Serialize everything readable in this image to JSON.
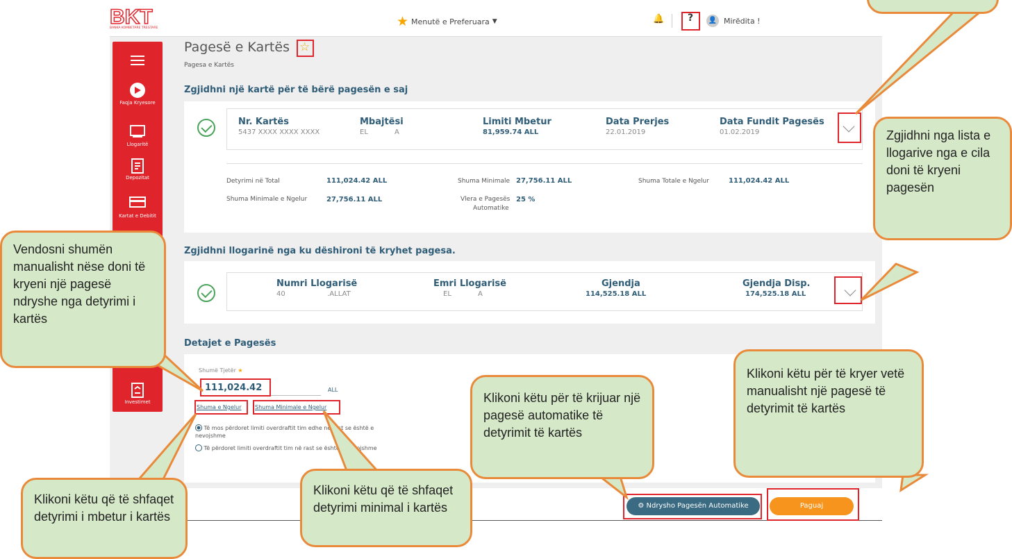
{
  "logo": {
    "text": "BKT",
    "subtitle": "BANKA KOMBETARE TREGTARE"
  },
  "topbar": {
    "favorites_label": "Menutë e Preferuara",
    "help_label": "?",
    "greeting": "Mirëdita !"
  },
  "sidebar": {
    "items": [
      {
        "label": "Faqja Kryesore"
      },
      {
        "label": "Llogaritë"
      },
      {
        "label": "Depozitat"
      },
      {
        "label": "Kartat e Debitit"
      },
      {
        "label": "Investimet"
      }
    ]
  },
  "page": {
    "title": "Pagesë e Kartës",
    "breadcrumb": "Pagesa e Kartës"
  },
  "card_section": {
    "title": "Zgjidhni një kartë për të bërë pagesën e saj",
    "columns": [
      "Nr. Kartës",
      "Mbajtësi",
      "Limiti Mbetur",
      "Data Prerjes",
      "Data Fundit Pagesës"
    ],
    "values": [
      "5437 XXXX XXXX XXXX",
      "EL            A",
      "81,959.74 ALL",
      "22.01.2019",
      "01.02.2019"
    ],
    "summary": {
      "total_debt_label": "Detyrimi në Total",
      "total_debt": "111,024.42 ALL",
      "min_label": "Shuma Minimale",
      "min": "27,756.11 ALL",
      "total_remaining_label": "Shuma Totale e Ngelur",
      "total_remaining": "111,024.42 ALL",
      "min_remaining_label": "Shuma Minimale e Ngelur",
      "min_remaining": "27,756.11 ALL",
      "auto_label_1": "Vlera e Pagesës",
      "auto_label_2": "Automatike",
      "auto_value": "25 %"
    }
  },
  "account_section": {
    "title": "Zgjidhni llogarinë nga ku dëshironi të kryhet pagesa.",
    "columns": [
      "Numri Llogarisë",
      "Emri Llogarisë",
      "Gjendja",
      "Gjendja Disp."
    ],
    "values": [
      "40                   .ALLAT",
      "EL            A",
      "114,525.18 ALL",
      "174,525.18 ALL"
    ]
  },
  "details": {
    "title": "Detajet e Pagesës",
    "amount_label": "Shumë Tjetër",
    "amount_value": "111,024.42",
    "currency": "ALL",
    "link_remaining": "Shuma e Ngelur",
    "link_min_remaining": "Shuma Minimale e Ngelur",
    "radio1": "Të mos përdoret limiti overdraftit tim edhe në rast se është e nevojshme",
    "radio2": "Të përdoret limiti overdraftit tim në rast se është e nevojshme"
  },
  "actions": {
    "auto_payment": "Ndrysho Pagesën Automatike",
    "pay": "Paguaj"
  },
  "callouts": {
    "choose_account": "Zgjidhni nga lista e llogarive nga e cila doni të kryeni pagesën",
    "manual_amount": "Vendosni shumën manualisht nëse doni të kryeni një pagesë ndryshe nga detyrimi i kartës",
    "remaining": "Klikoni këtu që të shfaqet detyrimi i mbetur i kartës",
    "minimal": "Klikoni këtu që të shfaqet detyrimi minimal i kartës",
    "auto": "Klikoni këtu për të krijuar një pagesë automatike të detyrimit të kartës",
    "manual_pay": "Klikoni këtu për të kryer vetë manualisht një pagesë të detyrimit të kartës"
  },
  "colors": {
    "brand_red": "#e0242c",
    "accent_blue": "#2f5d78",
    "pay_orange": "#f7941d",
    "callout_fill": "#d5e8c8",
    "callout_border": "#e98a3b"
  }
}
